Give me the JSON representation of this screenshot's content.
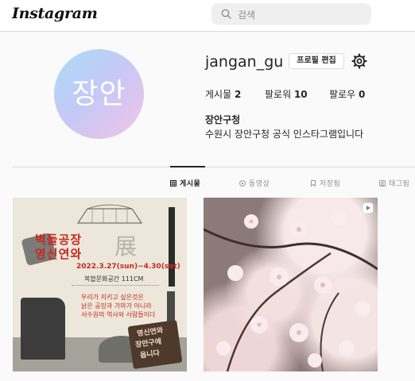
{
  "header": {
    "logo": "Instagram",
    "search_placeholder": "검색"
  },
  "profile": {
    "avatar_text": "장안",
    "username": "jangan_gu",
    "edit_button": "프로필 편집",
    "stats": {
      "posts_label": "게시물",
      "posts_count": "2",
      "followers_label": "팔로워",
      "followers_count": "10",
      "following_label": "팔로우",
      "following_count": "0"
    },
    "full_name": "장안구청",
    "bio": "수원시 장안구청 공식 인스타그램입니다"
  },
  "tabs": [
    {
      "label": "게시물",
      "icon": "grid-icon",
      "active": true
    },
    {
      "label": "동영상",
      "icon": "video-icon",
      "active": false
    },
    {
      "label": "저장됨",
      "icon": "bookmark-icon",
      "active": false
    },
    {
      "label": "태그됨",
      "icon": "tag-icon",
      "active": false
    }
  ],
  "posts": [
    {
      "type": "image",
      "poster": {
        "title_line1": "벽돌공장",
        "title_line2": "영신연와",
        "title_big": "展",
        "date": "2022.3.27(sun)~4.30(sat)",
        "place": "복합문화공간 111CM",
        "line1": "우리가 지키고 싶은것은",
        "line2": "낡은 공장과 가마가 아니라",
        "line3": "서수원의 역사와 사람들이다",
        "badge_line1": "영신연와",
        "badge_line2": "장안구에",
        "badge_line3": "옵니다"
      }
    },
    {
      "type": "reel",
      "icon": "reel-icon"
    }
  ],
  "colors": {
    "poster_red": "#c52a1e",
    "border": "#dbdbdb",
    "muted": "#8e8e8e"
  }
}
